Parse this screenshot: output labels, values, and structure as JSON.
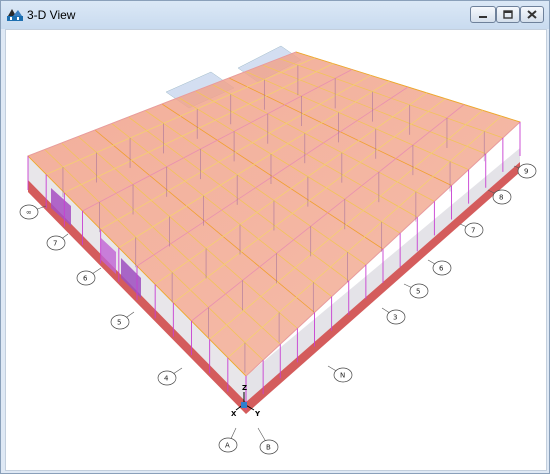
{
  "window": {
    "title": "3-D View",
    "icon": "structure-app-icon",
    "controls": {
      "minimize": "minimize-icon",
      "maximize": "maximize-icon",
      "close": "close-icon"
    }
  },
  "grid_bubbles": {
    "left_row": [
      "∞",
      "7",
      "6",
      "5",
      "4"
    ],
    "right_row": [
      "Ν",
      "3",
      "5",
      "6",
      "7",
      "8",
      "9"
    ],
    "front": [
      "A",
      "B"
    ]
  },
  "axes": {
    "z": "Z",
    "x": "X",
    "y": "Y"
  }
}
